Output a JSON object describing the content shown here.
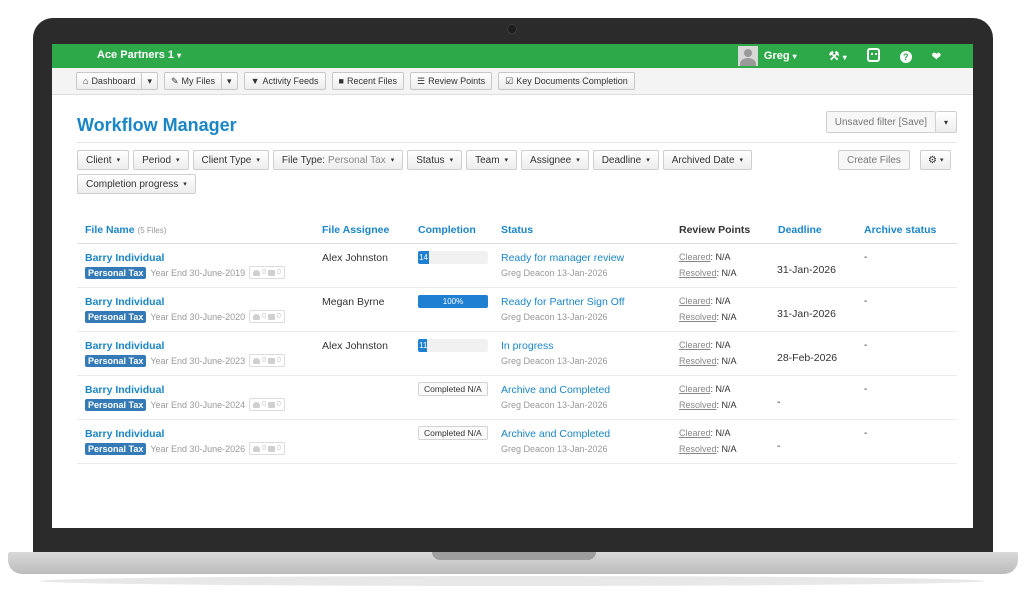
{
  "topbar": {
    "org_name": "Ace Partners 1",
    "org_caret": "▾",
    "user_name": "Greg",
    "caret": "▾",
    "wrench": "🔧",
    "help": "?",
    "heart": "❤"
  },
  "nav": {
    "dashboard": "Dashboard",
    "my_files": "My Files",
    "activity_feeds": "Activity Feeds",
    "recent_files": "Recent Files",
    "review_points": "Review Points",
    "key_documents": "Key Documents Completion",
    "caret": "▾"
  },
  "page": {
    "title": "Workflow Manager",
    "unsaved_filter": "Unsaved filter [Save]",
    "caret": "▾"
  },
  "filters": {
    "client": "Client",
    "period": "Period",
    "client_type": "Client Type",
    "file_type_label": "File Type:",
    "file_type_value": "Personal Tax",
    "status": "Status",
    "team": "Team",
    "assignee": "Assignee",
    "deadline": "Deadline",
    "archived_date": "Archived Date",
    "completion_progress": "Completion progress",
    "caret": "▾",
    "create_files": "Create Files",
    "gear": "⚙"
  },
  "table": {
    "headers": {
      "file_name": "File Name",
      "file_count": "(5 Files)",
      "file_assignee": "File Assignee",
      "completion": "Completion",
      "status": "Status",
      "review_points": "Review Points",
      "deadline": "Deadline",
      "archive_status": "Archive status"
    },
    "cleared_label": "Cleared",
    "resolved_label": "Resolved",
    "rows": [
      {
        "client": "Barry Individual",
        "tag": "Personal Tax",
        "period": "Year End 30-June-2019",
        "users_count": "0",
        "comments_count": "0",
        "assignee": "Alex Johnston",
        "completion_percent": 14,
        "completion_text": "14",
        "status": "Ready for manager review",
        "status_by": "Greg Deacon 13-Jan-2026",
        "cleared": ": N/A",
        "resolved": ": N/A",
        "deadline": "31-Jan-2026",
        "archive": "-"
      },
      {
        "client": "Barry Individual",
        "tag": "Personal Tax",
        "period": "Year End 30-June-2020",
        "users_count": "0",
        "comments_count": "0",
        "assignee": "Megan Byrne",
        "completion_percent": 100,
        "completion_text": "100%",
        "status": "Ready for Partner Sign Off",
        "status_by": "Greg Deacon 13-Jan-2026",
        "cleared": ": N/A",
        "resolved": ": N/A",
        "deadline": "31-Jan-2026",
        "archive": "-"
      },
      {
        "client": "Barry Individual",
        "tag": "Personal Tax",
        "period": "Year End 30-June-2023",
        "users_count": "0",
        "comments_count": "0",
        "assignee": "Alex Johnston",
        "completion_percent": 11,
        "completion_text": "11",
        "status": "In progress",
        "status_by": "Greg Deacon 13-Jan-2026",
        "cleared": ": N/A",
        "resolved": ": N/A",
        "deadline": "28-Feb-2026",
        "archive": "-"
      },
      {
        "client": "Barry Individual",
        "tag": "Personal Tax",
        "period": "Year End 30-June-2024",
        "users_count": "0",
        "comments_count": "0",
        "assignee": "",
        "completed_text": "Completed N/A",
        "status": "Archive and Completed",
        "status_by": "Greg Deacon 13-Jan-2026",
        "cleared": ": N/A",
        "resolved": ": N/A",
        "deadline": "-",
        "archive": "-"
      },
      {
        "client": "Barry Individual",
        "tag": "Personal Tax",
        "period": "Year End 30-June-2026",
        "users_count": "0",
        "comments_count": "0",
        "assignee": "",
        "completed_text": "Completed N/A",
        "status": "Archive and Completed",
        "status_by": "Greg Deacon 13-Jan-2026",
        "cleared": ": N/A",
        "resolved": ": N/A",
        "deadline": "-",
        "archive": "-"
      }
    ]
  },
  "colors": {
    "topbar": "#2ea94a",
    "link": "#1a86c8",
    "tag": "#337ab7",
    "progress": "#1f7fd0"
  }
}
